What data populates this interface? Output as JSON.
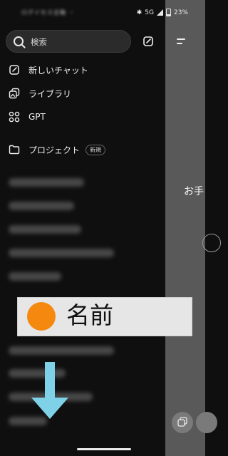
{
  "status_bar": {
    "left_text": "ログイセス主軸 ・",
    "network": "5G",
    "battery": "23%"
  },
  "search": {
    "placeholder": "検索"
  },
  "nav": [
    {
      "label": "新しいチャット",
      "icon": "edit-icon"
    },
    {
      "label": "ライブラリ",
      "icon": "library-icon"
    },
    {
      "label": "GPT",
      "icon": "grid-icon"
    },
    {
      "label": "プロジェクト",
      "icon": "folder-icon",
      "badge": "新規"
    }
  ],
  "main": {
    "greeting": "お手"
  },
  "overlay": {
    "text": "名前",
    "dot_color": "#f5880f"
  },
  "colors": {
    "arrow": "#7ed1e6",
    "background": "#0f0f0f"
  }
}
